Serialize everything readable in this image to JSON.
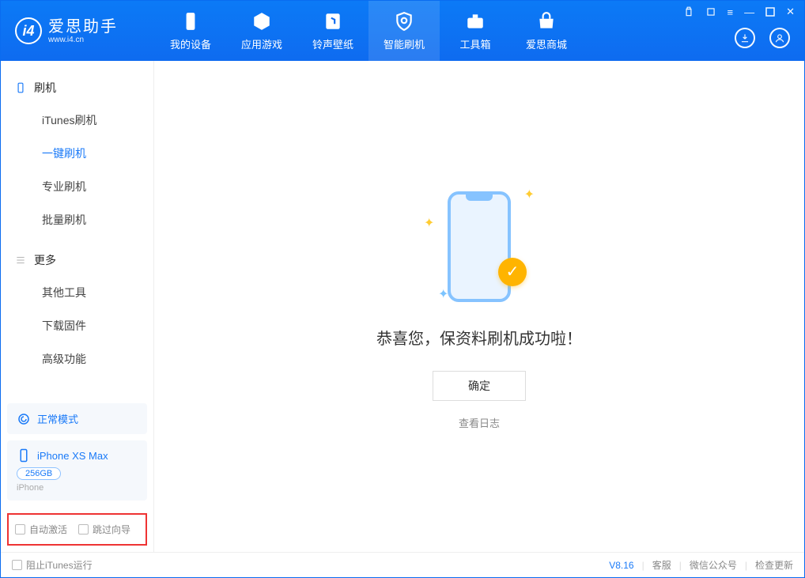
{
  "app": {
    "name": "爱思助手",
    "url": "www.i4.cn"
  },
  "tabs": [
    {
      "label": "我的设备"
    },
    {
      "label": "应用游戏"
    },
    {
      "label": "铃声壁纸"
    },
    {
      "label": "智能刷机"
    },
    {
      "label": "工具箱"
    },
    {
      "label": "爱思商城"
    }
  ],
  "sidebar": {
    "section1_title": "刷机",
    "items1": [
      {
        "label": "iTunes刷机"
      },
      {
        "label": "一键刷机"
      },
      {
        "label": "专业刷机"
      },
      {
        "label": "批量刷机"
      }
    ],
    "section2_title": "更多",
    "items2": [
      {
        "label": "其他工具"
      },
      {
        "label": "下载固件"
      },
      {
        "label": "高级功能"
      }
    ]
  },
  "mode_card": {
    "label": "正常模式"
  },
  "device_card": {
    "name": "iPhone XS Max",
    "storage": "256GB",
    "type": "iPhone"
  },
  "bottom_options": {
    "auto_activate": "自动激活",
    "skip_guide": "跳过向导"
  },
  "main": {
    "success_text": "恭喜您，保资料刷机成功啦！",
    "ok_button": "确定",
    "view_log": "查看日志"
  },
  "footer": {
    "block_itunes": "阻止iTunes运行",
    "version": "V8.16",
    "support": "客服",
    "wechat": "微信公众号",
    "check_update": "检查更新"
  }
}
